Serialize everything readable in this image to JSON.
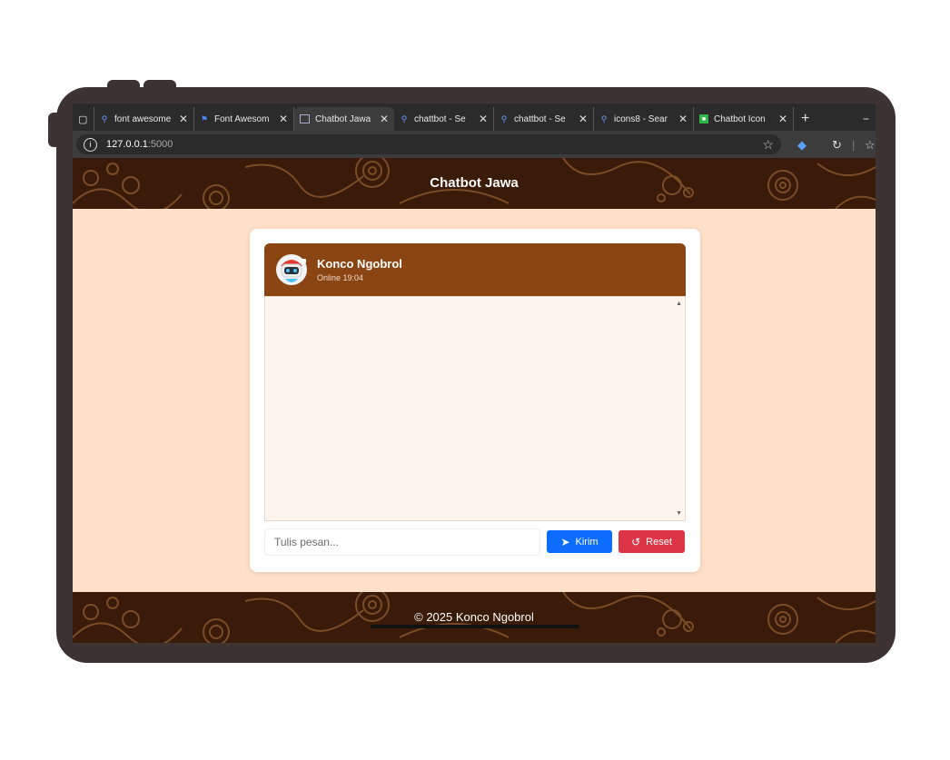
{
  "browser": {
    "tabs": [
      {
        "title": "font awesome",
        "icon": "search-icon"
      },
      {
        "title": "Font Awesom",
        "icon": "flag-icon"
      },
      {
        "title": "Chatbot Jawa",
        "icon": "page-icon",
        "active": true
      },
      {
        "title": "chattbot - Se",
        "icon": "search-icon"
      },
      {
        "title": "chattbot - Se",
        "icon": "search-icon"
      },
      {
        "title": "icons8 - Sear",
        "icon": "search-icon"
      },
      {
        "title": "Chatbot Icon",
        "icon": "green-square-icon"
      }
    ],
    "url_host": "127.0.0.1",
    "url_port": ":5000"
  },
  "site": {
    "title": "Chatbot Jawa",
    "footer": "© 2025 Konco Ngobrol"
  },
  "chat": {
    "bot_name": "Konco Ngobrol",
    "status": "Online 19:04",
    "input_placeholder": "Tulis pesan...",
    "send_label": "Kirim",
    "reset_label": "Reset"
  },
  "colors": {
    "header_brown": "#8b4513",
    "batik_bg": "#3a1a08",
    "page_bg": "#ffe0c8",
    "send_blue": "#0d6efd",
    "reset_red": "#dc3545"
  }
}
